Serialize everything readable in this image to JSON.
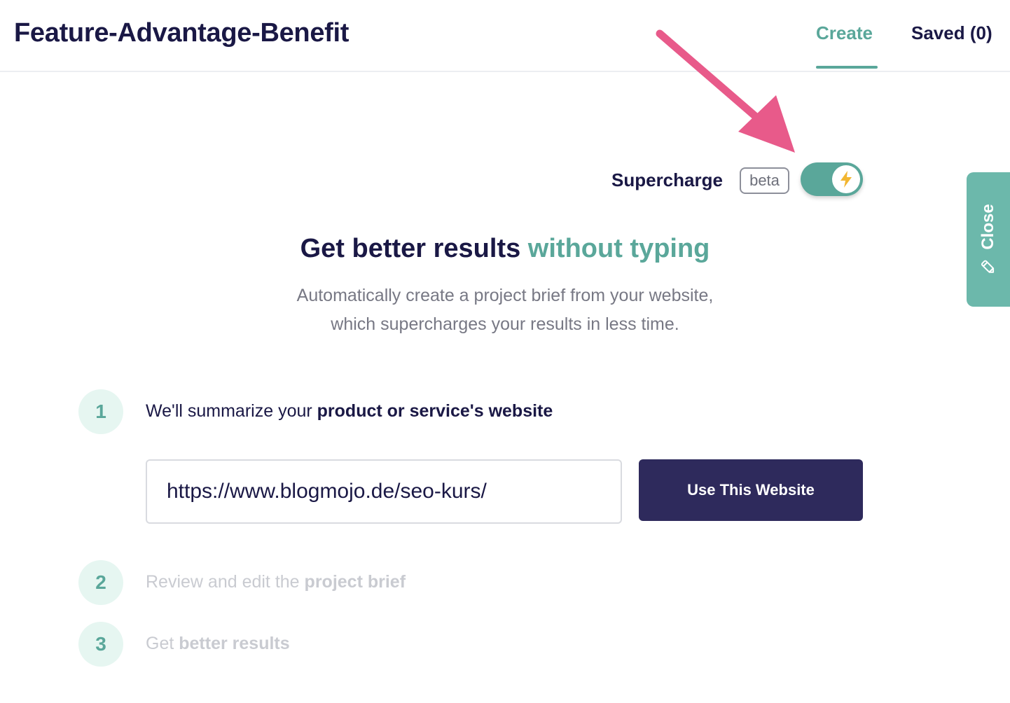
{
  "header": {
    "title": "Feature-Advantage-Benefit",
    "tabs": [
      {
        "label": "Create",
        "active": true
      },
      {
        "label": "Saved (0)",
        "active": false
      }
    ]
  },
  "supercharge": {
    "label": "Supercharge",
    "badge": "beta",
    "toggle_on": true,
    "toggle_icon": "lightning-bolt-icon"
  },
  "intro": {
    "heading_main": "Get better results",
    "heading_accent": "without typing",
    "description_line1": "Automatically create a project brief from your website,",
    "description_line2": "which supercharges your results in less time."
  },
  "steps": [
    {
      "number": "1",
      "text_plain": "We'll summarize your",
      "text_bold": "product or service's website",
      "active": true
    },
    {
      "number": "2",
      "text_plain": "Review and edit the",
      "text_bold": "project brief",
      "active": false
    },
    {
      "number": "3",
      "text_plain": "Get",
      "text_bold": "better results",
      "active": false
    }
  ],
  "website_input": {
    "value": "https://www.blogmojo.de/seo-kurs/"
  },
  "use_button": {
    "label": "Use This Website"
  },
  "side_panel": {
    "label": "Close",
    "icon": "pencil-icon"
  },
  "colors": {
    "accent": "#5aa79a",
    "navy": "#1a1845",
    "button": "#2e2a5c",
    "arrow": "#e85a8a",
    "step_circle_bg": "#e6f6f1"
  }
}
